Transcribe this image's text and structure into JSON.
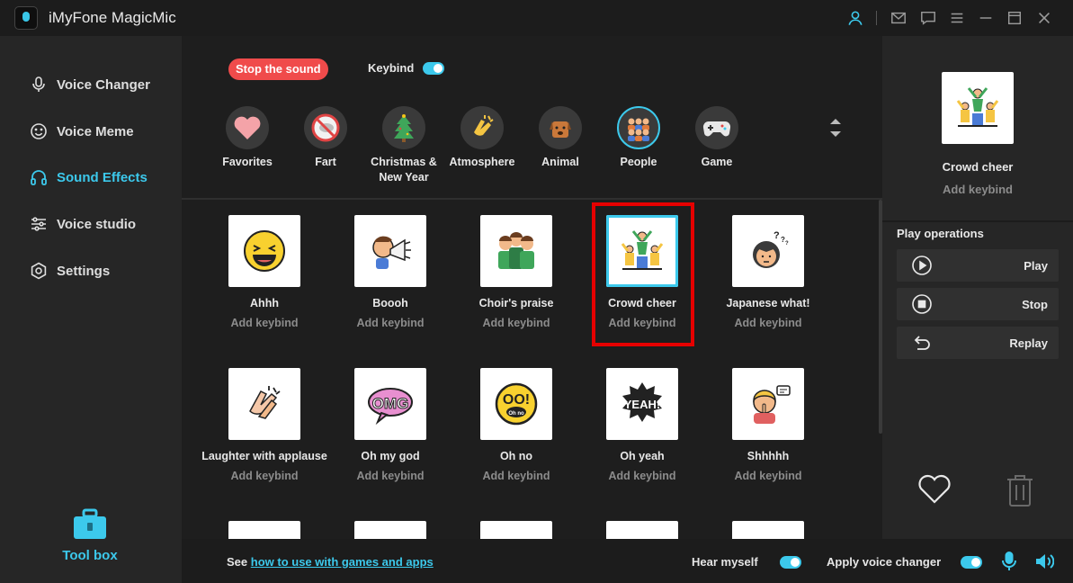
{
  "app": {
    "title": "iMyFone MagicMic"
  },
  "sidebar": {
    "items": [
      {
        "label": "Voice Changer",
        "icon": "microphone-icon"
      },
      {
        "label": "Voice Meme",
        "icon": "smile-icon"
      },
      {
        "label": "Sound Effects",
        "icon": "headphones-icon",
        "active": true
      },
      {
        "label": "Voice studio",
        "icon": "sliders-icon"
      },
      {
        "label": "Settings",
        "icon": "gear-icon"
      }
    ],
    "toolbox_label": "Tool box"
  },
  "toolbar": {
    "stop_label": "Stop the sound",
    "keybind_label": "Keybind",
    "keybind_on": true
  },
  "categories": [
    {
      "label": "Favorites",
      "icon": "heart-icon"
    },
    {
      "label": "Fart",
      "icon": "fart-icon"
    },
    {
      "label": "Christmas & New Year",
      "icon": "christmas-tree-icon"
    },
    {
      "label": "Atmosphere",
      "icon": "clapping-hands-icon"
    },
    {
      "label": "Animal",
      "icon": "dog-icon"
    },
    {
      "label": "People",
      "icon": "people-icon",
      "active": true
    },
    {
      "label": "Game",
      "icon": "gamepad-icon"
    }
  ],
  "sounds": [
    {
      "name": "Ahhh",
      "keybind": "Add keybind"
    },
    {
      "name": "Boooh",
      "keybind": "Add keybind"
    },
    {
      "name": "Choir's praise",
      "keybind": "Add keybind"
    },
    {
      "name": "Crowd cheer",
      "keybind": "Add keybind",
      "selected": true
    },
    {
      "name": "Japanese what!",
      "keybind": "Add keybind"
    },
    {
      "name": "Laughter with applause",
      "keybind": "Add keybind"
    },
    {
      "name": "Oh my god",
      "keybind": "Add keybind"
    },
    {
      "name": "Oh no",
      "keybind": "Add keybind"
    },
    {
      "name": "Oh yeah",
      "keybind": "Add keybind"
    },
    {
      "name": "Shhhhh",
      "keybind": "Add keybind"
    }
  ],
  "sound_tile_text": {
    "omg": "OMG",
    "ohno_big": "OO!",
    "ohno_small": "Oh no",
    "yeah": "YEAH!"
  },
  "right_panel": {
    "selected_name": "Crowd cheer",
    "selected_keybind": "Add keybind",
    "play_operations_label": "Play operations",
    "play_label": "Play",
    "stop_label": "Stop",
    "replay_label": "Replay"
  },
  "bottom": {
    "see_prefix": "See",
    "see_link": "how to use with games and apps",
    "hear_myself_label": "Hear myself",
    "apply_voice_changer_label": "Apply voice changer",
    "hear_myself_on": true,
    "apply_voice_changer_on": true
  },
  "colors": {
    "accent": "#3cc9ec",
    "danger": "#f04b4b",
    "highlight": "#e60000"
  }
}
